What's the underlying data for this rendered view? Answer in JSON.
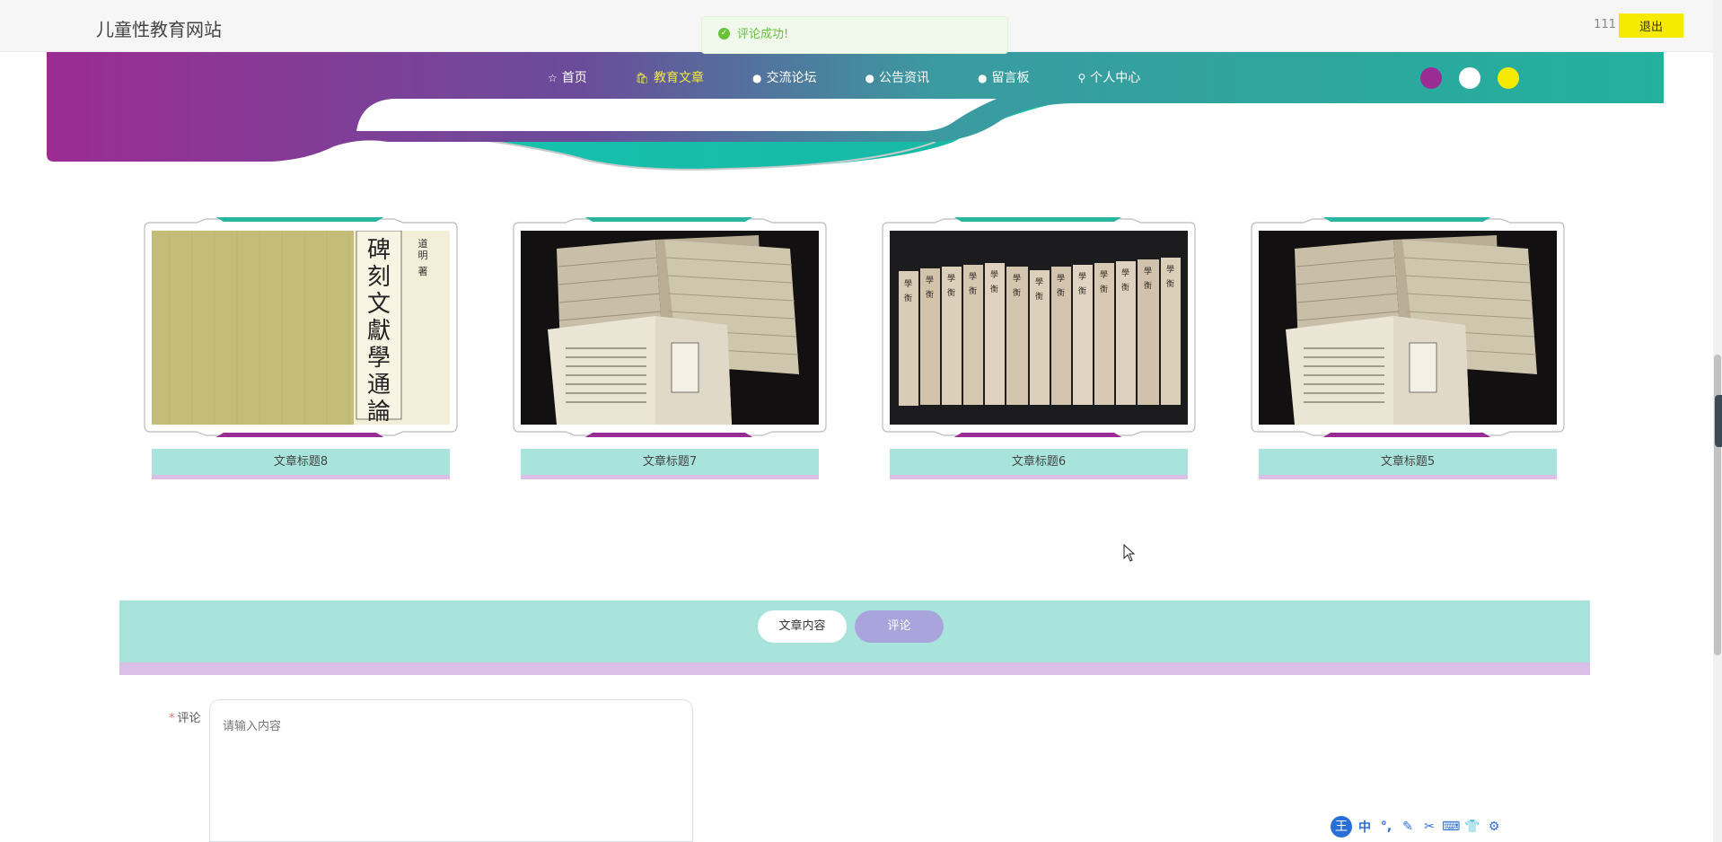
{
  "header": {
    "site_title": "儿童性教育网站",
    "username": "111",
    "logout_label": "退出"
  },
  "toast": {
    "message": "评论成功!",
    "icon": "check-circle-icon"
  },
  "nav": {
    "items": [
      {
        "label": "首页",
        "icon": "star-icon",
        "active": false
      },
      {
        "label": "教育文章",
        "icon": "bag-icon",
        "active": true
      },
      {
        "label": "交流论坛",
        "icon": "info-icon",
        "active": false
      },
      {
        "label": "公告资讯",
        "icon": "info-icon",
        "active": false
      },
      {
        "label": "留言板",
        "icon": "info-icon",
        "active": false
      },
      {
        "label": "个人中心",
        "icon": "user-icon",
        "active": false
      }
    ],
    "theme_colors": [
      "#9b2c93",
      "#ffffff",
      "#f5ea00"
    ]
  },
  "articles": [
    {
      "title": "文章标题8",
      "image": "book-cover-calligraphy"
    },
    {
      "title": "文章标题7",
      "image": "stacked-old-books"
    },
    {
      "title": "文章标题6",
      "image": "row-of-book-spines"
    },
    {
      "title": "文章标题5",
      "image": "stacked-old-books"
    }
  ],
  "tabs": {
    "content_label": "文章内容",
    "comment_label": "评论"
  },
  "comment_form": {
    "required_mark": "*",
    "label": "评论",
    "placeholder": "请输入内容"
  },
  "book_cover_text": {
    "main": "碑刻文獻學通論",
    "author": "道明",
    "suffix": "著"
  },
  "ime_toolbar": {
    "logo": "王",
    "lang": "中"
  },
  "colors": {
    "teal": "#2ab5a0",
    "purple": "#9b2c93",
    "tab_band": "#a8e4dc",
    "lilac": "#dcbfe6",
    "active_tab": "#a9a4dc",
    "logout": "#f5ea00"
  }
}
